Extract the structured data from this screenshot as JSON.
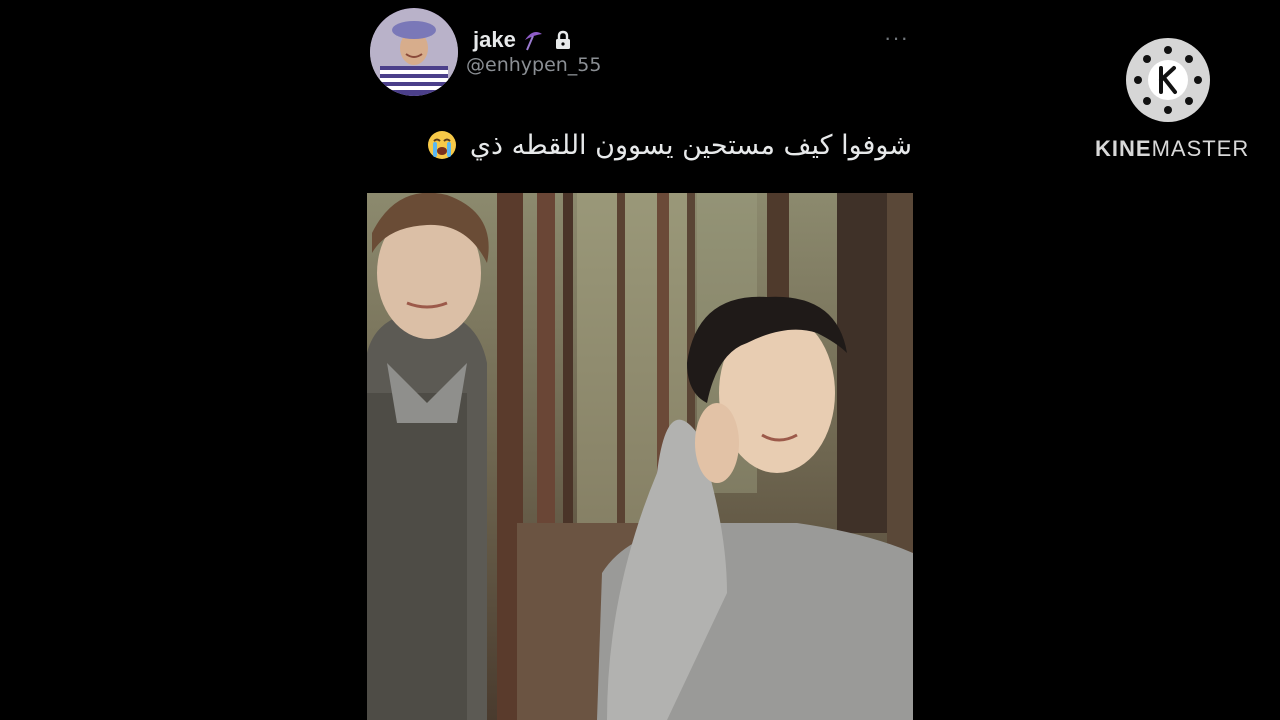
{
  "tweet": {
    "display_name": "jake",
    "name_emoji": "umbrella-icon",
    "locked_icon": "lock-icon",
    "handle": "@enhypen_55",
    "more_icon": "more-horizontal-icon",
    "text": "شوفوا كيف مستحين يسوون اللقطه ذي",
    "text_emoji": "loudly-crying-face-icon",
    "media_description_icon": "photo-two-people-forest"
  },
  "watermark": {
    "logo_icon": "kinemaster-logo-icon",
    "brand_bold": "KINE",
    "brand_regular": "MASTER"
  },
  "colors": {
    "background": "#000000",
    "text_primary": "#e7e9ea",
    "text_secondary": "#8b8f94",
    "watermark": "#d8d8d8"
  }
}
